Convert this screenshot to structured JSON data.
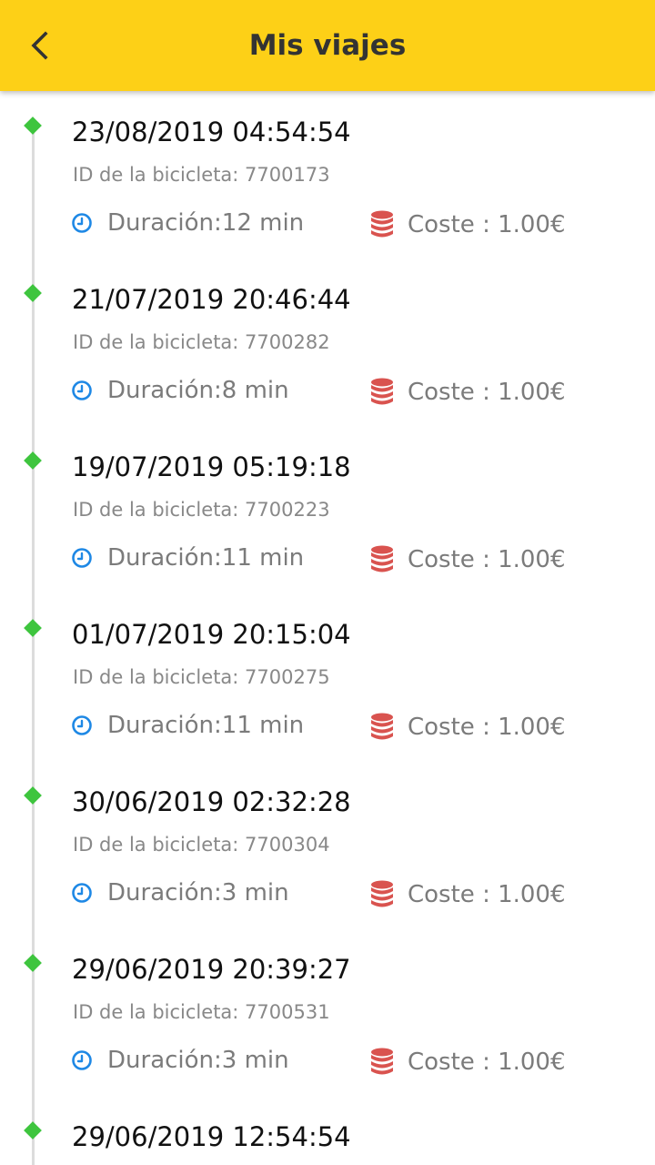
{
  "header": {
    "title": "Mis viajes",
    "back_icon": "chevron-left-icon",
    "background_color": "#fdd017"
  },
  "trips": [
    {
      "date": "23/08/2019 04:54:54",
      "bike_label": "ID de la bicicleta:  7700173",
      "duration": "Duración:12 min",
      "cost": "Coste : 1.00€"
    },
    {
      "date": "21/07/2019 20:46:44",
      "bike_label": "ID de la bicicleta:  7700282",
      "duration": "Duración:8 min",
      "cost": "Coste : 1.00€"
    },
    {
      "date": "19/07/2019 05:19:18",
      "bike_label": "ID de la bicicleta:  7700223",
      "duration": "Duración:11 min",
      "cost": "Coste : 1.00€"
    },
    {
      "date": "01/07/2019 20:15:04",
      "bike_label": "ID de la bicicleta:  7700275",
      "duration": "Duración:11 min",
      "cost": "Coste : 1.00€"
    },
    {
      "date": "30/06/2019 02:32:28",
      "bike_label": "ID de la bicicleta:  7700304",
      "duration": "Duración:3 min",
      "cost": "Coste : 1.00€"
    },
    {
      "date": "29/06/2019 20:39:27",
      "bike_label": "ID de la bicicleta:  7700531",
      "duration": "Duración:3 min",
      "cost": "Coste : 1.00€"
    },
    {
      "date": "29/06/2019 12:54:54"
    }
  ],
  "icons": {
    "clock": "clock-icon",
    "coins": "coins-icon",
    "timeline_dot": "diamond-dot"
  },
  "colors": {
    "accent_yellow": "#fdd017",
    "timeline_green": "#3ec53e",
    "clock_blue": "#1e88e5",
    "coins_red": "#d9534f"
  }
}
